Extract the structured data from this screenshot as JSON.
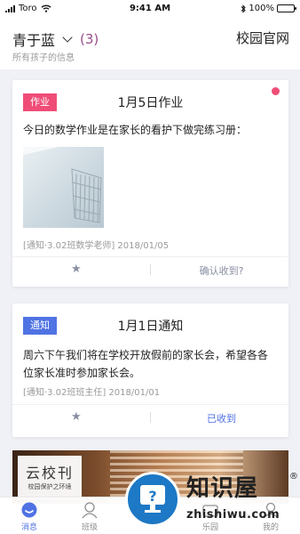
{
  "status_bar": {
    "carrier": "Toro",
    "time": "9:41 AM",
    "battery": "100%"
  },
  "header": {
    "child_name": "青于蓝",
    "child_count": "(3)",
    "subtitle": "所有孩子的信息",
    "site_link": "校园官网"
  },
  "cards": [
    {
      "tag": "作业",
      "tag_color": "#ef4d77",
      "title": "1月5日作业",
      "unread": true,
      "body": "今日的数学作业是在家长的看护下做完练习册：",
      "has_image": true,
      "meta": "[通知·3.02班数学老师]  2018/01/05",
      "action": "确认收到?"
    },
    {
      "tag": "通知",
      "tag_color": "#4f73e3",
      "title": "1月1日通知",
      "body": "周六下午我们将在学校开放假前的家长会，希望各各位家长准时参加家长会。",
      "meta": "[通知·3.02班班主任]  2018/01/01",
      "action": "已收到"
    }
  ],
  "banner": {
    "title": "云校刊",
    "subtitle": "校园保护之环境"
  },
  "tabbar": {
    "items": [
      {
        "label": "消息"
      },
      {
        "label": "班级"
      },
      {
        "label": "乐园"
      },
      {
        "label": "我的"
      }
    ]
  },
  "watermark": {
    "brand": "知识屋",
    "registered": "®",
    "url": "zhishiwu.com",
    "icon_glyph": "?"
  },
  "icons": {
    "favorite": "star-icon",
    "dropdown": "chevron-down-icon"
  }
}
